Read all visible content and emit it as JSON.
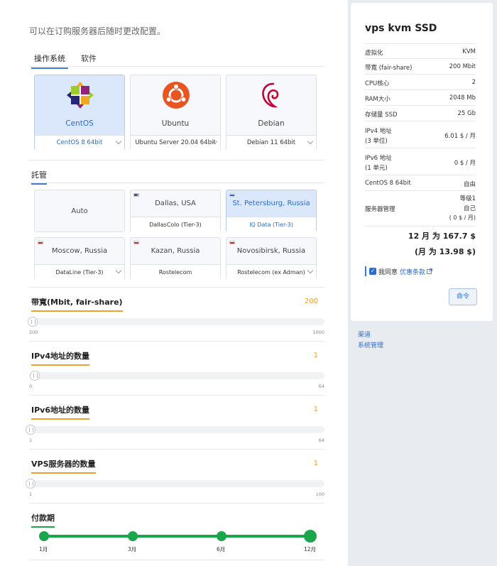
{
  "intro": "可以在订购服务器后随时更改配置。",
  "tabs": [
    {
      "label": "操作系统"
    },
    {
      "label": "软件"
    }
  ],
  "os": [
    {
      "name": "CentOS",
      "version": "CentOS 8 64bit",
      "selected": true
    },
    {
      "name": "Ubuntu",
      "version": "Ubuntu Server 20.04 64bit",
      "selected": false
    },
    {
      "name": "Debian",
      "version": "Debian 11 64bit",
      "selected": false
    }
  ],
  "hosting": {
    "label": "託管",
    "locations": [
      {
        "name": "Auto",
        "provider": ""
      },
      {
        "name": "Dallas, USA",
        "provider": "DallasColo (Tier-3)"
      },
      {
        "name": "St. Petersburg, Russia",
        "provider": "IQ Data (Tier-3)"
      },
      {
        "name": "Moscow, Russia",
        "provider": "DataLine (Tier-3)"
      },
      {
        "name": "Kazan, Russia",
        "provider": "Rostelecom"
      },
      {
        "name": "Novosibirsk, Russia",
        "provider": "Rostelecom (ex Adman)"
      }
    ]
  },
  "sliders": [
    {
      "label": "带寬(Mbit, fair-share)",
      "value": "200",
      "min": "200",
      "max": "1000"
    },
    {
      "label": "IPv4地址的数量",
      "value": "1",
      "min": "0",
      "max": "64"
    },
    {
      "label": "IPv6地址的数量",
      "value": "1",
      "min": "1",
      "max": "64"
    },
    {
      "label": "VPS服务器的数量",
      "value": "1",
      "min": "1",
      "max": "100"
    }
  ],
  "payment": {
    "label": "付款期",
    "options": [
      {
        "label": "1月"
      },
      {
        "label": "3月"
      },
      {
        "label": "6月"
      },
      {
        "label": "12月"
      }
    ],
    "selected": "12月"
  },
  "summary": {
    "title": "vps kvm SSD",
    "specs": [
      {
        "key": "虚拟化",
        "value": "KVM"
      },
      {
        "key": "带寬 (fair-share)",
        "value": "200 Mbit"
      },
      {
        "key": "CPU核心",
        "value": "2"
      },
      {
        "key": "RAM大小",
        "value": "2048 Mb"
      },
      {
        "key": "存储量 SSD",
        "value": "25 Gb"
      },
      {
        "key": "IPv4 地址",
        "key2": "(3 单位)",
        "value": "6.01 $ / 月"
      },
      {
        "key": "IPv6 地址",
        "key2": "(1 单元)",
        "value": "0 $ / 月"
      },
      {
        "key": "CentOS 8 64bit",
        "value": "自由"
      },
      {
        "key": "服务器管理",
        "value": "等级1",
        "value2": "自己",
        "value3": "( 0 $ / 月)"
      }
    ],
    "total_line1": "12 月 为 167.7 $",
    "total_line2": "(月 为 13.98 $)",
    "agree_text": "我同意",
    "agree_link": "优惠条款",
    "order_button": "命令"
  },
  "side_links": [
    {
      "label": "渠道"
    },
    {
      "label": "系统管理"
    }
  ]
}
